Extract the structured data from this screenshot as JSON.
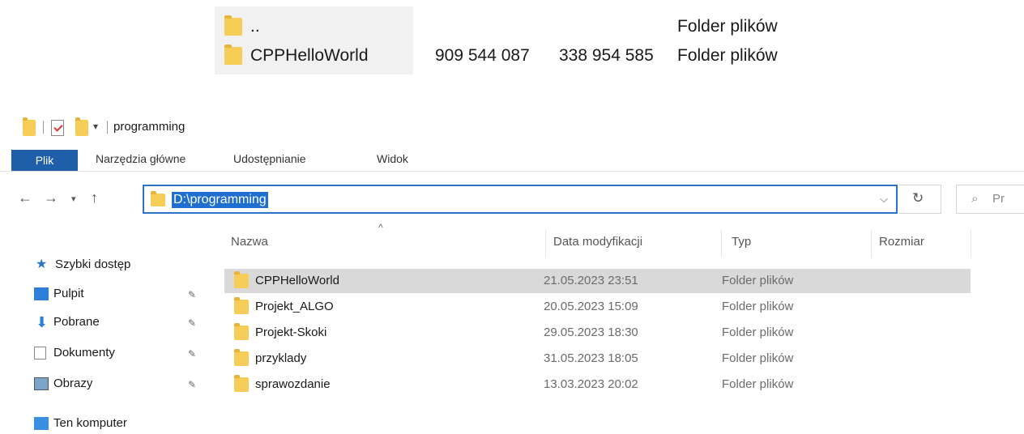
{
  "top_listing": {
    "rows": [
      {
        "name": "..",
        "col1": "",
        "col2": "",
        "type": "Folder plików"
      },
      {
        "name": "CPPHelloWorld",
        "col1": "909 544 087",
        "col2": "338 954 585",
        "type": "Folder plików"
      }
    ]
  },
  "window": {
    "title": "programming",
    "ribbon_tabs": [
      "Plik",
      "Narzędzia główne",
      "Udostępnianie",
      "Widok"
    ],
    "address": "D:\\programming",
    "search_placeholder": "Pr"
  },
  "sidebar": {
    "quick_access": "Szybki dostęp",
    "items": [
      "Pulpit",
      "Pobrane",
      "Dokumenty",
      "Obrazy"
    ],
    "this_pc": "Ten komputer"
  },
  "file_list": {
    "columns": [
      "Nazwa",
      "Data modyfikacji",
      "Typ",
      "Rozmiar"
    ],
    "rows": [
      {
        "name": "CPPHelloWorld",
        "date": "21.05.2023 23:51",
        "type": "Folder plików",
        "selected": true
      },
      {
        "name": "Projekt_ALGO",
        "date": "20.05.2023 15:09",
        "type": "Folder plików",
        "selected": false
      },
      {
        "name": "Projekt-Skoki",
        "date": "29.05.2023 18:30",
        "type": "Folder plików",
        "selected": false
      },
      {
        "name": "przyklady",
        "date": "31.05.2023 18:05",
        "type": "Folder plików",
        "selected": false
      },
      {
        "name": "sprawozdanie",
        "date": "13.03.2023 20:02",
        "type": "Folder plików",
        "selected": false
      }
    ]
  },
  "colors": {
    "accent": "#1f5ea8",
    "selection": "#d9d9d9",
    "folder": "#f6cd57"
  }
}
